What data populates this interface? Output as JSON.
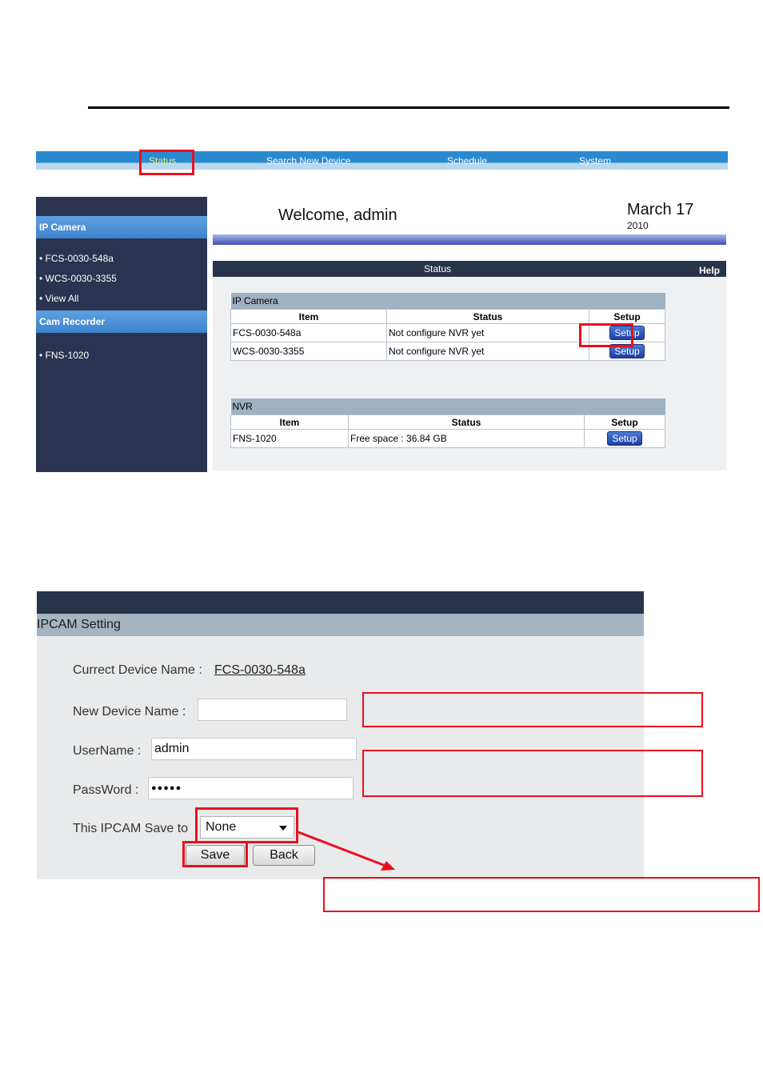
{
  "nav": {
    "items": [
      "Status",
      "Search New Device",
      "Schedule",
      "System"
    ]
  },
  "sidebar": {
    "sections": [
      {
        "title": "IP Camera",
        "items": [
          "• FCS-0030-548a",
          "• WCS-0030-3355",
          "• View All"
        ]
      },
      {
        "title": "Cam Recorder",
        "items": [
          "• FNS-1020"
        ]
      }
    ]
  },
  "header": {
    "welcome": "Welcome, admin",
    "date": "March 17",
    "year": "2010"
  },
  "status_panel": {
    "title": "Status",
    "help": "Help"
  },
  "ipcam_table": {
    "caption": "IP Camera",
    "columns": [
      "Item",
      "Status",
      "Setup"
    ],
    "rows": [
      {
        "item": "FCS-0030-548a",
        "status": "Not configure NVR yet",
        "setup": "Setup"
      },
      {
        "item": "WCS-0030-3355",
        "status": "Not configure NVR yet",
        "setup": "Setup"
      }
    ]
  },
  "nvr_table": {
    "caption": "NVR",
    "columns": [
      "Item",
      "Status",
      "Setup"
    ],
    "rows": [
      {
        "item": "FNS-1020",
        "status": "Free space : 36.84 GB",
        "setup": "Setup"
      }
    ]
  },
  "ipcam_setting": {
    "title": "IPCAM Setting",
    "current_device_label": "Currect Device Name :",
    "current_device_value": "FCS-0030-548a",
    "new_device_label": "New Device Name :",
    "new_device_value": "",
    "username_label": "UserName :",
    "username_value": "admin",
    "password_label": "PassWord :",
    "password_value": "●●●●●",
    "save_to_label": "This IPCAM Save to",
    "save_to_selected": "None",
    "save_label": "Save",
    "back_label": "Back"
  },
  "colors": {
    "highlight": "#e8101e",
    "nav_blue": "#2a8ad0",
    "sidebar_dark": "#2a3450"
  }
}
